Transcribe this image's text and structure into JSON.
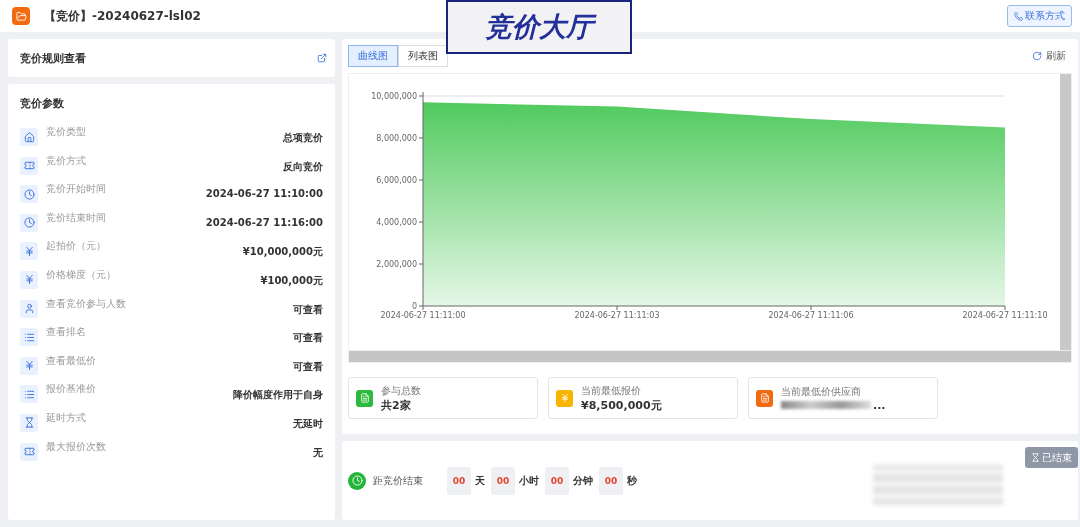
{
  "header": {
    "title": "【竞价】-20240627-lsl02",
    "overlay_title": "竞价大厅",
    "contact_button": "联系方式"
  },
  "rules_card": {
    "title": "竞价规则查看"
  },
  "params": {
    "title": "竞价参数",
    "rows": [
      {
        "label": "竞价类型",
        "value": "总项竞价"
      },
      {
        "label": "竞价方式",
        "value": "反向竞价"
      },
      {
        "label": "竞价开始时间",
        "value": "2024-06-27 11:10:00"
      },
      {
        "label": "竞价结束时间",
        "value": "2024-06-27 11:16:00"
      },
      {
        "label": "起拍价（元）",
        "value": "¥10,000,000元"
      },
      {
        "label": "价格梯度（元）",
        "value": "¥100,000元"
      },
      {
        "label": "查看竞价参与人数",
        "value": "可查看"
      },
      {
        "label": "查看排名",
        "value": "可查看"
      },
      {
        "label": "查看最低价",
        "value": "可查看"
      },
      {
        "label": "报价基准价",
        "value": "降价幅度作用于自身"
      },
      {
        "label": "延时方式",
        "value": "无延时"
      },
      {
        "label": "最大报价次数",
        "value": "无"
      }
    ]
  },
  "view_tabs": [
    {
      "label": "曲线图",
      "selected": true
    },
    {
      "label": "列表图",
      "selected": false
    }
  ],
  "refresh_button": "刷新",
  "chart": {
    "chart_data": {
      "type": "area",
      "categories": [
        "2024-06-27 11:11:00",
        "2024-06-27 11:11:03",
        "2024-06-27 11:11:06",
        "2024-06-27 11:11:10"
      ],
      "series": [
        {
          "color": "#4cc95a",
          "values": [
            9700000,
            9500000,
            8900000,
            8500000
          ]
        }
      ],
      "ylim": [
        0,
        10000000
      ],
      "yticks": [
        {
          "value": 0,
          "label": "0"
        },
        {
          "value": 2000000,
          "label": "2,000,000"
        },
        {
          "value": 4000000,
          "label": "4,000,000"
        },
        {
          "value": 6000000,
          "label": "6,000,000"
        },
        {
          "value": 8000000,
          "label": "8,000,000"
        },
        {
          "value": 10000000,
          "label": "10,000,000"
        }
      ]
    }
  },
  "stats": [
    {
      "color": "#2db93d",
      "label": "参与总数",
      "value": "共2家",
      "blurred": false
    },
    {
      "color": "#f8b500",
      "label": "当前最低报价",
      "value": "¥8,500,000元",
      "blurred": false
    },
    {
      "color": "#f26b10",
      "label": "当前最低价供应商",
      "value": "...",
      "blurred": true
    }
  ],
  "countdown": {
    "label": "距竞价结束",
    "units": [
      {
        "value": "00",
        "unit": "天"
      },
      {
        "value": "00",
        "unit": "小时"
      },
      {
        "value": "00",
        "unit": "分钟"
      },
      {
        "value": "00",
        "unit": "秒"
      }
    ],
    "status_button": "已结束"
  }
}
